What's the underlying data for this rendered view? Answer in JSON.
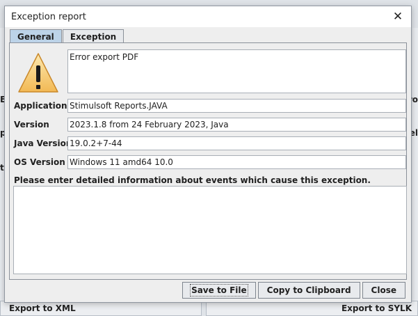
{
  "background": {
    "left_partial_labels": [
      "E:",
      "po",
      "t"
    ],
    "right_partial_labels": [
      "ro",
      "el"
    ],
    "bottom_left_label": "Export to XML",
    "bottom_right_label": "Export to SYLK"
  },
  "dialog": {
    "title": "Exception report",
    "close_glyph": "✕"
  },
  "tabs": [
    {
      "label": "General",
      "active": true
    },
    {
      "label": "Exception",
      "active": false
    }
  ],
  "general": {
    "icon": "warning-triangle-icon",
    "message": "Error export PDF",
    "fields": [
      {
        "label": "Application",
        "value": "Stimulsoft Reports.JAVA"
      },
      {
        "label": "Version",
        "value": "2023.1.8 from 24 February 2023, Java"
      },
      {
        "label": "Java Version",
        "value": "19.0.2+7-44"
      },
      {
        "label": "OS Version",
        "value": "Windows 11  amd64 10.0"
      }
    ],
    "details_prompt": "Please enter detailed information about events which cause this exception.",
    "details_value": ""
  },
  "buttons": {
    "save": "Save to File",
    "copy": "Copy to Clipboard",
    "close": "Close"
  }
}
